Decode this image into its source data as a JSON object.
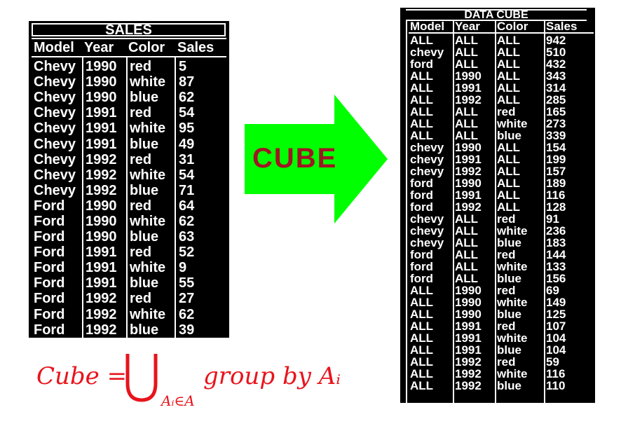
{
  "sales": {
    "title": "SALES",
    "headers": [
      "Model",
      "Year",
      "Color",
      "Sales"
    ],
    "rows": [
      [
        "Chevy",
        "1990",
        "red",
        "5"
      ],
      [
        "Chevy",
        "1990",
        "white",
        "87"
      ],
      [
        "Chevy",
        "1990",
        "blue",
        "62"
      ],
      [
        "Chevy",
        "1991",
        "red",
        "54"
      ],
      [
        "Chevy",
        "1991",
        "white",
        "95"
      ],
      [
        "Chevy",
        "1991",
        "blue",
        "49"
      ],
      [
        "Chevy",
        "1992",
        "red",
        "31"
      ],
      [
        "Chevy",
        "1992",
        "white",
        "54"
      ],
      [
        "Chevy",
        "1992",
        "blue",
        "71"
      ],
      [
        "Ford",
        "1990",
        "red",
        "64"
      ],
      [
        "Ford",
        "1990",
        "white",
        "62"
      ],
      [
        "Ford",
        "1990",
        "blue",
        "63"
      ],
      [
        "Ford",
        "1991",
        "red",
        "52"
      ],
      [
        "Ford",
        "1991",
        "white",
        "9"
      ],
      [
        "Ford",
        "1991",
        "blue",
        "55"
      ],
      [
        "Ford",
        "1992",
        "red",
        "27"
      ],
      [
        "Ford",
        "1992",
        "white",
        "62"
      ],
      [
        "Ford",
        "1992",
        "blue",
        "39"
      ]
    ]
  },
  "arrow": {
    "label": "CUBE",
    "color": "#00ff00",
    "label_color": "#a01525"
  },
  "formula": {
    "lhs": "Cube =",
    "union_symbol": "⋃",
    "subscript": "Aᵢ∈A",
    "rhs": "group by Aᵢ",
    "color": "#e8141c"
  },
  "cube": {
    "title": "DATA CUBE",
    "headers": [
      "Model",
      "Year",
      "Color",
      "Sales"
    ],
    "rows": [
      [
        "ALL",
        "ALL",
        "ALL",
        "942"
      ],
      [
        "chevy",
        "ALL",
        "ALL",
        "510"
      ],
      [
        "ford",
        "ALL",
        "ALL",
        "432"
      ],
      [
        "ALL",
        "1990",
        "ALL",
        "343"
      ],
      [
        "ALL",
        "1991",
        "ALL",
        "314"
      ],
      [
        "ALL",
        "1992",
        "ALL",
        "285"
      ],
      [
        "ALL",
        "ALL",
        "red",
        "165"
      ],
      [
        "ALL",
        "ALL",
        "white",
        "273"
      ],
      [
        "ALL",
        "ALL",
        "blue",
        "339"
      ],
      [
        "chevy",
        "1990",
        "ALL",
        "154"
      ],
      [
        "chevy",
        "1991",
        "ALL",
        "199"
      ],
      [
        "chevy",
        "1992",
        "ALL",
        "157"
      ],
      [
        "ford",
        "1990",
        "ALL",
        "189"
      ],
      [
        "ford",
        "1991",
        "ALL",
        "116"
      ],
      [
        "ford",
        "1992",
        "ALL",
        "128"
      ],
      [
        "chevy",
        "ALL",
        "red",
        "91"
      ],
      [
        "chevy",
        "ALL",
        "white",
        "236"
      ],
      [
        "chevy",
        "ALL",
        "blue",
        "183"
      ],
      [
        "ford",
        "ALL",
        "red",
        "144"
      ],
      [
        "ford",
        "ALL",
        "white",
        "133"
      ],
      [
        "ford",
        "ALL",
        "blue",
        "156"
      ],
      [
        "ALL",
        "1990",
        "red",
        "69"
      ],
      [
        "ALL",
        "1990",
        "white",
        "149"
      ],
      [
        "ALL",
        "1990",
        "blue",
        "125"
      ],
      [
        "ALL",
        "1991",
        "red",
        "107"
      ],
      [
        "ALL",
        "1991",
        "white",
        "104"
      ],
      [
        "ALL",
        "1991",
        "blue",
        "104"
      ],
      [
        "ALL",
        "1992",
        "red",
        "59"
      ],
      [
        "ALL",
        "1992",
        "white",
        "116"
      ],
      [
        "ALL",
        "1992",
        "blue",
        "110"
      ]
    ]
  }
}
